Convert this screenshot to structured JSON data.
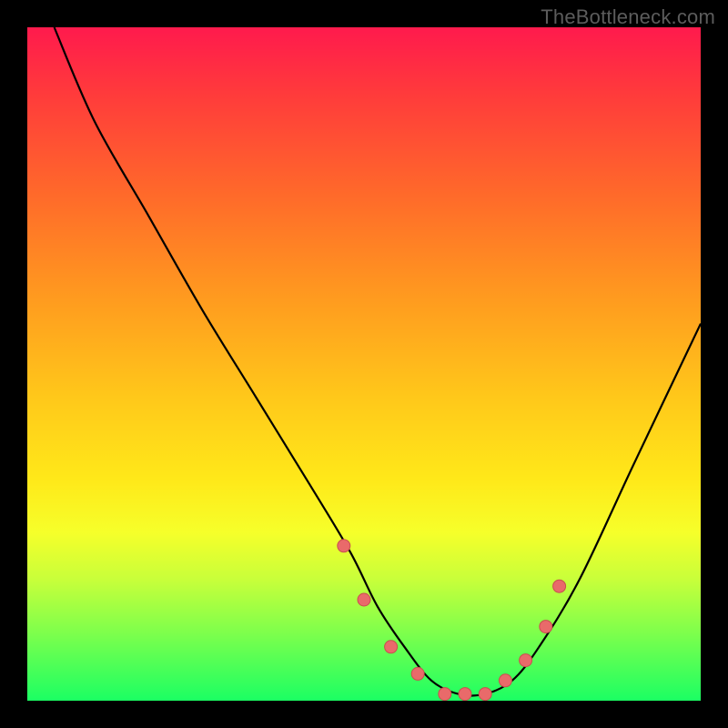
{
  "watermark": "TheBottleneck.com",
  "chart_data": {
    "type": "line",
    "title": "",
    "xlabel": "",
    "ylabel": "",
    "xlim": [
      0,
      100
    ],
    "ylim": [
      0,
      100
    ],
    "grid": false,
    "legend": false,
    "background_gradient": {
      "top": "#ff1a4d",
      "mid": "#ffe819",
      "bottom": "#1bff63"
    },
    "series": [
      {
        "name": "bottleneck-curve",
        "x": [
          4,
          10,
          18,
          26,
          34,
          42,
          48,
          52,
          56,
          60,
          64,
          68,
          72,
          76,
          82,
          90,
          100
        ],
        "values": [
          100,
          86,
          72,
          58,
          45,
          32,
          22,
          14,
          8,
          3,
          1,
          1,
          3,
          8,
          18,
          35,
          56
        ]
      }
    ],
    "markers": {
      "name": "highlight-points",
      "x": [
        47,
        50,
        54,
        58,
        62,
        65,
        68,
        71,
        74,
        77,
        79
      ],
      "values": [
        23,
        15,
        8,
        4,
        1,
        1,
        1,
        3,
        6,
        11,
        17
      ]
    }
  }
}
